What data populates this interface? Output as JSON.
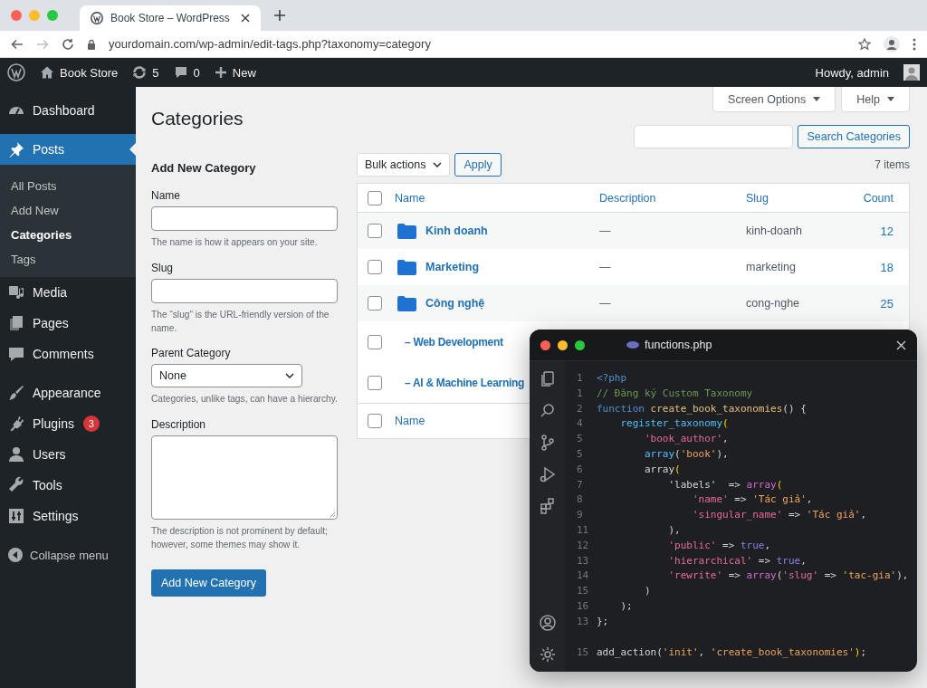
{
  "browser": {
    "tab_title": "Book Store – WordPress",
    "url": "yourdomain.com/wp-admin/edit-tags.php?taxonomy=category"
  },
  "admin_bar": {
    "site_name": "Book Store",
    "updates": "5",
    "comments": "0",
    "new_label": "New",
    "greeting": "Howdy, admin"
  },
  "menu_groups": [
    [
      {
        "label": "Dashboard",
        "selected": false
      }
    ],
    [
      {
        "label": "Posts",
        "selected": true,
        "expanded": true,
        "submenu": [
          {
            "label": "All Posts",
            "selected": false
          },
          {
            "label": "Add New",
            "selected": false
          },
          {
            "label": "Categories",
            "selected": true
          },
          {
            "label": "Tags",
            "selected": false
          }
        ]
      },
      {
        "label": "Media",
        "selected": false
      },
      {
        "label": "Pages",
        "selected": false
      },
      {
        "label": "Comments",
        "selected": false
      }
    ],
    [
      {
        "label": "Appearance",
        "selected": false
      },
      {
        "label": "Plugins",
        "selected": false,
        "badge": "3"
      },
      {
        "label": "Users",
        "selected": false
      },
      {
        "label": "Tools",
        "selected": false
      },
      {
        "label": "Settings",
        "selected": false
      }
    ]
  ],
  "collapse_label": "Collapse menu",
  "screen_options": "Screen Options",
  "help": "Help",
  "heading": "Categories",
  "form": {
    "title": "Add New Category",
    "fields": [
      {
        "kind": "text",
        "label": "Name",
        "hint": "The name is how it appears on your site."
      },
      {
        "kind": "text",
        "label": "Slug",
        "hint": "The “slug” is the URL-friendly version of the name."
      },
      {
        "kind": "select",
        "label": "Parent Category",
        "value": "None",
        "hint": "Categories, unlike tags, can have a hierarchy."
      },
      {
        "kind": "textarea",
        "label": "Description",
        "hint": "The description is not prominent by default; however, some themes may show it."
      }
    ],
    "submit": "Add New Category"
  },
  "search": {
    "button": "Search Categories"
  },
  "bulk": {
    "label": "Bulk actions",
    "apply": "Apply",
    "count": "7 items"
  },
  "table": {
    "columns": [
      "Name",
      "Description",
      "Slug",
      "Count"
    ],
    "header_checked": false,
    "rows": [
      {
        "name": "Kinh doanh",
        "description": "—",
        "slug": "kinh-doanh",
        "count": "12",
        "checked": false
      },
      {
        "name": "Marketing",
        "description": "—",
        "slug": "marketing",
        "count": "18",
        "checked": false
      },
      {
        "name": "Công nghệ",
        "description": "—",
        "slug": "cong-nghe",
        "count": "25",
        "checked": false,
        "children": [
          {
            "name": "– Web Development",
            "checked": false
          },
          {
            "name": "– AI & Machine Learning",
            "checked": false
          }
        ]
      }
    ],
    "footer_column": "Name",
    "footer_checked": false
  },
  "editor": {
    "filename": "functions.php",
    "lines": [
      {
        "number": "1",
        "tokens": [
          {
            "kind": "keyword",
            "text": "<?php"
          }
        ]
      },
      {
        "number": "1",
        "tokens": [
          {
            "kind": "comment",
            "text": "// Đăng ký Custom Taxonomy"
          }
        ]
      },
      {
        "number": "2",
        "tokens": [
          {
            "kind": "keyword",
            "text": "function "
          },
          {
            "kind": "func",
            "text": "create_book_taxonomies"
          },
          {
            "kind": "plain",
            "text": "() {"
          }
        ]
      },
      {
        "number": "4",
        "tokens": [
          {
            "kind": "call",
            "text": "    register_taxonomy"
          },
          {
            "kind": "bracket",
            "text": "("
          }
        ]
      },
      {
        "number": "5",
        "tokens": [
          {
            "kind": "key",
            "text": "        'book_author'"
          },
          {
            "kind": "plain",
            "text": ","
          }
        ]
      },
      {
        "number": "5",
        "tokens": [
          {
            "kind": "call",
            "text": "        array"
          },
          {
            "kind": "plain",
            "text": "("
          },
          {
            "kind": "string",
            "text": "'book'"
          },
          {
            "kind": "plain",
            "text": "),"
          }
        ]
      },
      {
        "number": "6",
        "tokens": [
          {
            "kind": "plain",
            "text": "        array"
          },
          {
            "kind": "bracket",
            "text": "("
          }
        ]
      },
      {
        "number": "7",
        "tokens": [
          {
            "kind": "plain",
            "text": "            'labels'  => "
          },
          {
            "kind": "magenta",
            "text": "array"
          },
          {
            "kind": "bracket",
            "text": "("
          }
        ]
      },
      {
        "number": "8",
        "tokens": [
          {
            "kind": "key",
            "text": "                'name'"
          },
          {
            "kind": "plain",
            "text": " => "
          },
          {
            "kind": "string",
            "text": "'Tác giả'"
          },
          {
            "kind": "plain",
            "text": ","
          }
        ]
      },
      {
        "number": "9",
        "tokens": [
          {
            "kind": "key",
            "text": "                'singular_name'"
          },
          {
            "kind": "plain",
            "text": " => "
          },
          {
            "kind": "string",
            "text": "'Tác giả'"
          },
          {
            "kind": "plain",
            "text": ","
          }
        ]
      },
      {
        "number": "11",
        "tokens": [
          {
            "kind": "plain",
            "text": "            ),"
          }
        ]
      },
      {
        "number": "12",
        "tokens": [
          {
            "kind": "key",
            "text": "            'public'"
          },
          {
            "kind": "plain",
            "text": " => "
          },
          {
            "kind": "bool",
            "text": "true"
          },
          {
            "kind": "plain",
            "text": ","
          }
        ]
      },
      {
        "number": "13",
        "tokens": [
          {
            "kind": "key",
            "text": "            'hierarchical'"
          },
          {
            "kind": "plain",
            "text": " => "
          },
          {
            "kind": "bool",
            "text": "true"
          },
          {
            "kind": "plain",
            "text": ","
          }
        ]
      },
      {
        "number": "14",
        "tokens": [
          {
            "kind": "key",
            "text": "            'rewrite'"
          },
          {
            "kind": "plain",
            "text": " => "
          },
          {
            "kind": "magenta",
            "text": "array"
          },
          {
            "kind": "plain",
            "text": "("
          },
          {
            "kind": "key",
            "text": "'slug'"
          },
          {
            "kind": "plain",
            "text": " => "
          },
          {
            "kind": "string",
            "text": "'tac-gia'"
          },
          {
            "kind": "plain",
            "text": "),"
          }
        ]
      },
      {
        "number": "15",
        "tokens": [
          {
            "kind": "plain",
            "text": "        )"
          }
        ]
      },
      {
        "number": "16",
        "tokens": [
          {
            "kind": "plain",
            "text": "    );"
          }
        ]
      },
      {
        "number": "13",
        "tokens": [
          {
            "kind": "plain",
            "text": "};"
          }
        ]
      }
    ],
    "footer_lines": [
      {
        "number": "15",
        "tokens": [
          {
            "kind": "plain",
            "text": "add_action("
          },
          {
            "kind": "string",
            "text": "'init'"
          },
          {
            "kind": "plain",
            "text": ", "
          },
          {
            "kind": "string",
            "text": "'create_book_taxonomies'"
          },
          {
            "kind": "bracket",
            "text": ")"
          },
          {
            "kind": "plain",
            "text": ";"
          }
        ]
      }
    ]
  }
}
